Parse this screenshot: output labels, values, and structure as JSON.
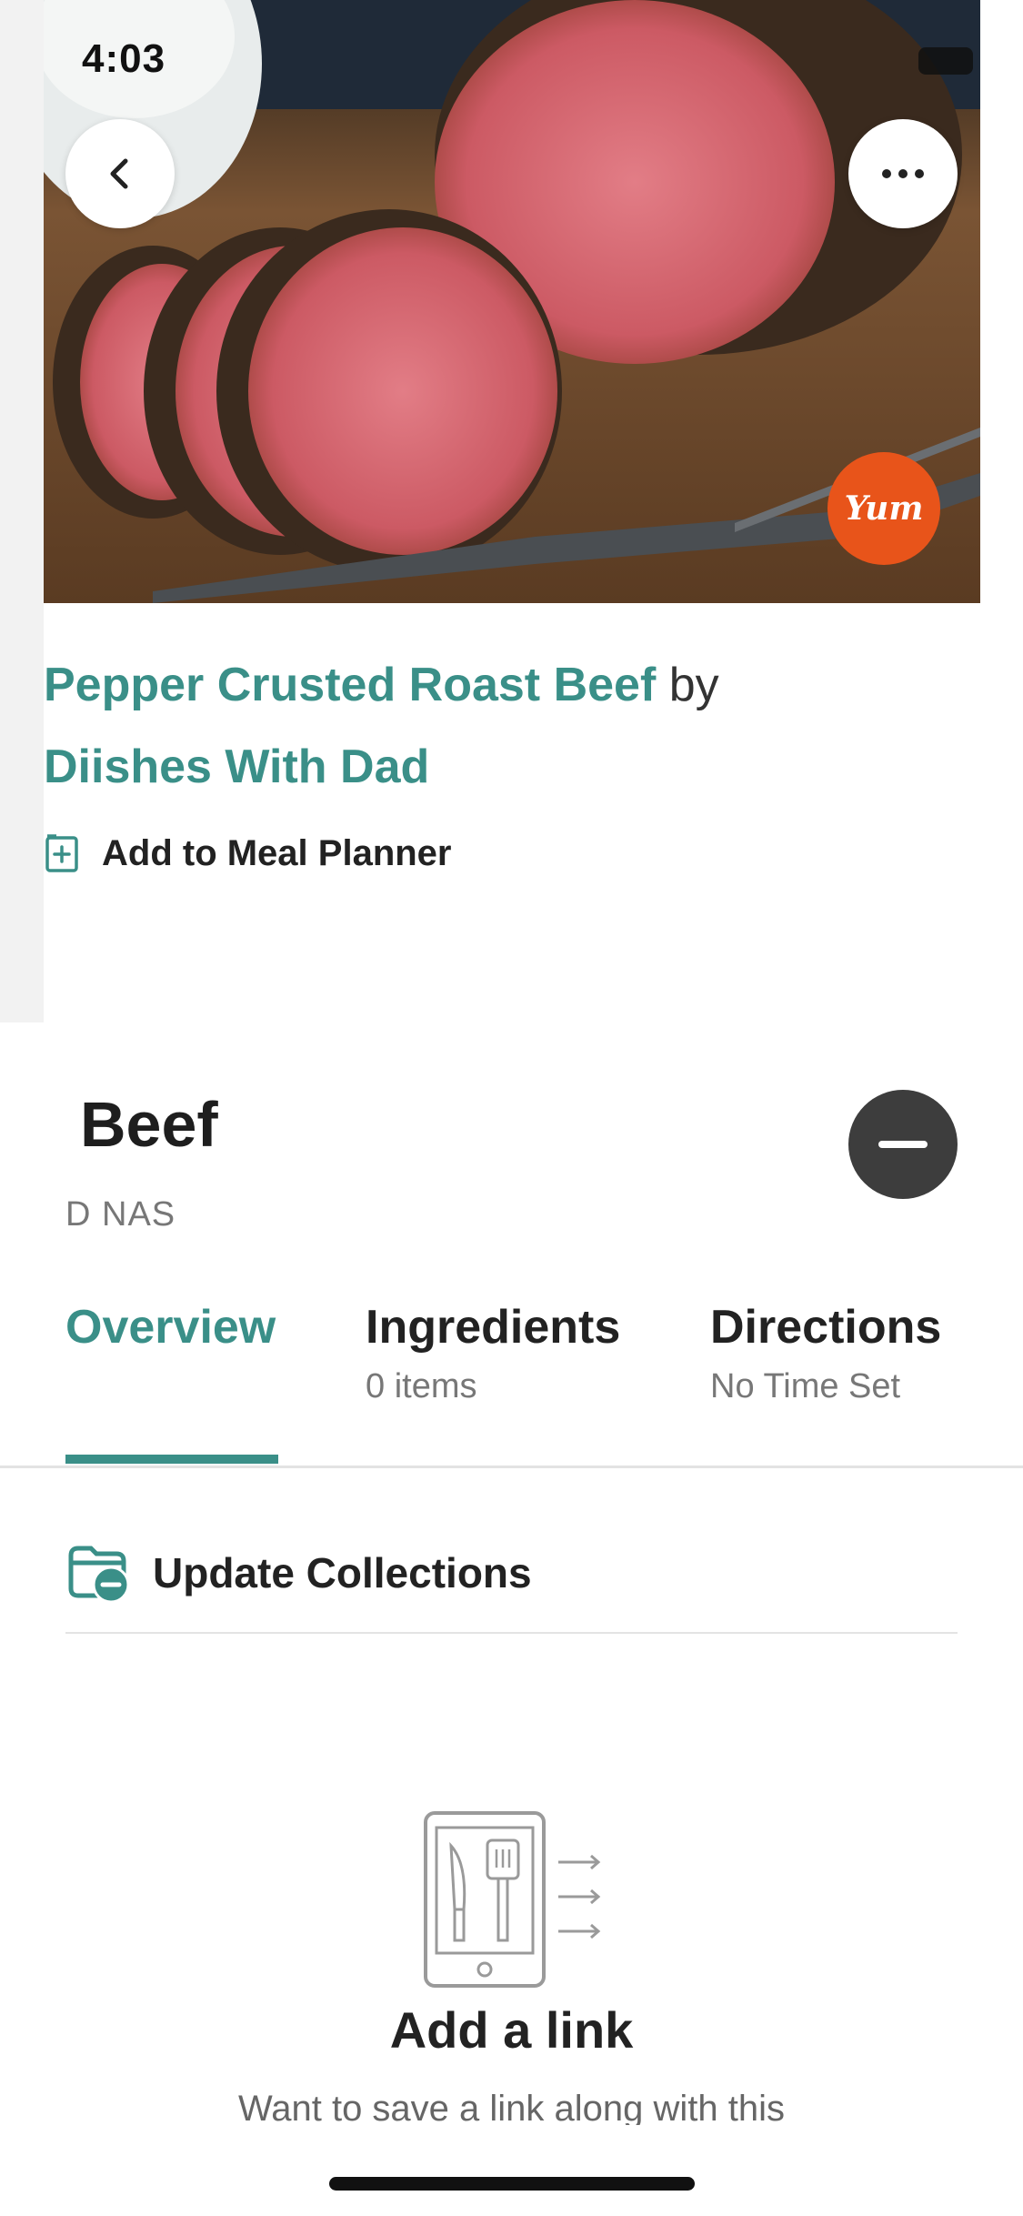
{
  "status_bar": {
    "time": "4:03",
    "battery": "89"
  },
  "hero": {
    "badge_text": "Yum"
  },
  "recipe": {
    "title": "Pepper Crusted Roast Beef",
    "by_word": "by",
    "author": "Diishes With Dad",
    "meal_planner_label": "Add to Meal Planner"
  },
  "sheet": {
    "title": "Beef",
    "subtitle": "D NAS",
    "tabs": [
      {
        "label": "Overview",
        "sub": ""
      },
      {
        "label": "Ingredients",
        "sub": "0 items"
      },
      {
        "label": "Directions",
        "sub": "No Time Set"
      }
    ],
    "update_collections_label": "Update Collections",
    "empty_state": {
      "title": "Add a link",
      "description": "Want to save a link along with this"
    }
  },
  "icons": {
    "back": "chevron-left-icon",
    "more": "ellipsis-icon",
    "meal_planner": "calendar-plus-icon",
    "remove": "minus-icon",
    "collections": "folder-minus-icon",
    "empty": "phone-utensils-icon"
  },
  "colors": {
    "accent": "#3a8f88",
    "badge": "#e8541a",
    "dark_button": "#3d3d3d"
  }
}
